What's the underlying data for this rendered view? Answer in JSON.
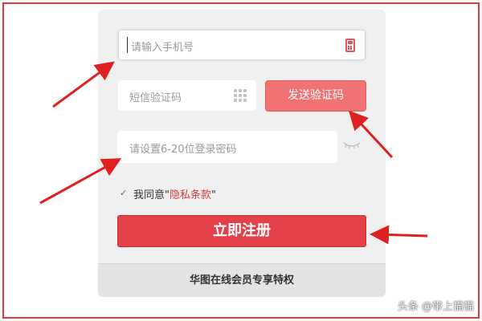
{
  "form": {
    "phone_placeholder": "请输入手机号",
    "sms_placeholder": "短信验证码",
    "send_code_label": "发送验证码",
    "password_placeholder": "请设置6-20位登录密码",
    "agree_prefix": "我同意\"",
    "agree_link": "隐私条款",
    "agree_suffix": "\"",
    "agree_checked": true,
    "register_label": "立即注册"
  },
  "footer": {
    "text": "华图在线会员专享特权"
  },
  "watermark": {
    "text": "头条 @带上猫猫"
  },
  "colors": {
    "accent": "#e34047",
    "send_button": "#f07272",
    "annotation": "#e02020",
    "card_bg": "#f0f0f0"
  },
  "icons": {
    "phone_field": "mobile-phone-icon",
    "sms_field": "keypad-grid-icon",
    "password_toggle": "eye-closed-icon",
    "agree": "checkmark-icon"
  }
}
